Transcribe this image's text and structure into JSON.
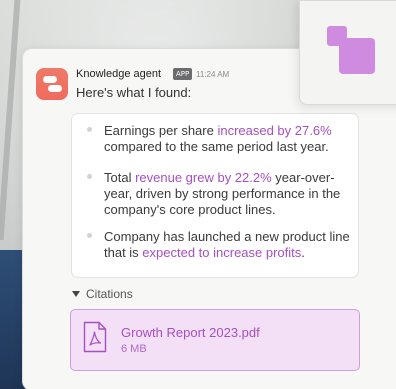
{
  "message": {
    "sender": "Knowledge agent",
    "badge": "APP",
    "time": "11:24 AM",
    "intro": "Here's what I found:"
  },
  "findings": [
    {
      "before": "Earnings per share ",
      "highlight": "increased by 27.6%",
      "after": " compared to the same period last year."
    },
    {
      "before": "Total ",
      "highlight": "revenue grew by 22.2%",
      "after": " year-over-year, driven by strong performance in the company's core product lines."
    },
    {
      "before": "Company has launched a new product line that is ",
      "highlight": "expected to increase profits",
      "after": "."
    }
  ],
  "citations": {
    "label": "Citations",
    "file": {
      "name": "Growth Report 2023.pdf",
      "size": "6 MB",
      "icon": "pdf-file-icon"
    }
  },
  "colors": {
    "accent": "#a64fc1",
    "avatar": "#f06a5c",
    "app_tile_shape": "#cf8be0",
    "attachment_bg": "#f3e0f7"
  }
}
